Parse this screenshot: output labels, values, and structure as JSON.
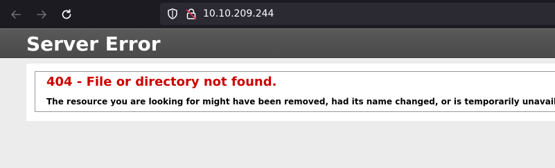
{
  "browser": {
    "back_icon": "arrow-left-icon",
    "forward_icon": "arrow-right-icon",
    "reload_icon": "reload-icon",
    "url": "10.10.209.244",
    "security_icons": [
      "shield-icon",
      "insecure-lock-icon"
    ]
  },
  "page": {
    "header_title": "Server Error",
    "error_heading": "404 - File or directory not found.",
    "error_message": "The resource you are looking for might have been removed, had its name changed, or is temporarily unavailable."
  },
  "colors": {
    "error_red": "#cc0000",
    "header_gray": "#525252",
    "browser_dark": "#1c1b22",
    "page_bg": "#ececec"
  }
}
